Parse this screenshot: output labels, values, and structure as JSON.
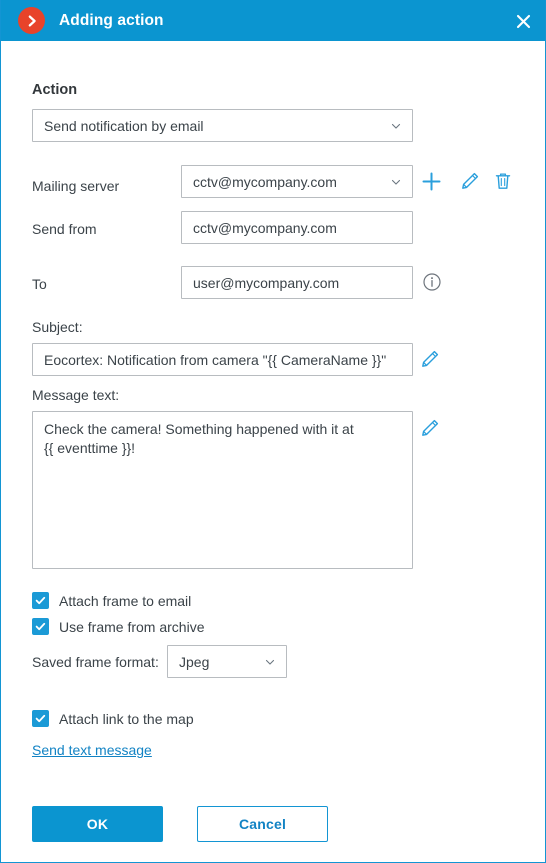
{
  "window": {
    "title": "Adding action",
    "logo_icon": "chevron-right-circle-icon",
    "close_icon": "close-icon",
    "header_color": "#0b95d0",
    "logo_color": "#e8432a"
  },
  "form": {
    "section_title": "Action",
    "action": {
      "value": "Send notification by email",
      "caret_icon": "chevron-down-icon"
    },
    "mailing_server": {
      "label": "Mailing server",
      "value": "cctv@mycompany.com",
      "add_icon": "plus-icon",
      "edit_icon": "pencil-icon",
      "delete_icon": "trash-icon"
    },
    "send_from": {
      "label": "Send from",
      "value": "cctv@mycompany.com"
    },
    "to": {
      "label": "To",
      "value": "user@mycompany.com",
      "info_icon": "info-circle-icon"
    },
    "subject": {
      "label": "Subject:",
      "value": "Eocortex: Notification from camera \"{{ CameraName }}\"",
      "edit_icon": "pencil-icon"
    },
    "message": {
      "label": "Message text:",
      "value": "Check the camera! Something happened with it at\n{{ eventtime }}!",
      "edit_icon": "pencil-icon"
    },
    "attach_frame": {
      "label": "Attach frame to email",
      "checked": true
    },
    "use_archive_frame": {
      "label": "Use frame from archive",
      "checked": true
    },
    "saved_frame_format": {
      "label": "Saved frame format:",
      "value": "Jpeg",
      "caret_icon": "chevron-down-icon"
    },
    "attach_map_link": {
      "label": "Attach link to the map",
      "checked": true
    },
    "sms_link": "Send text message"
  },
  "footer": {
    "ok_label": "OK",
    "cancel_label": "Cancel"
  }
}
